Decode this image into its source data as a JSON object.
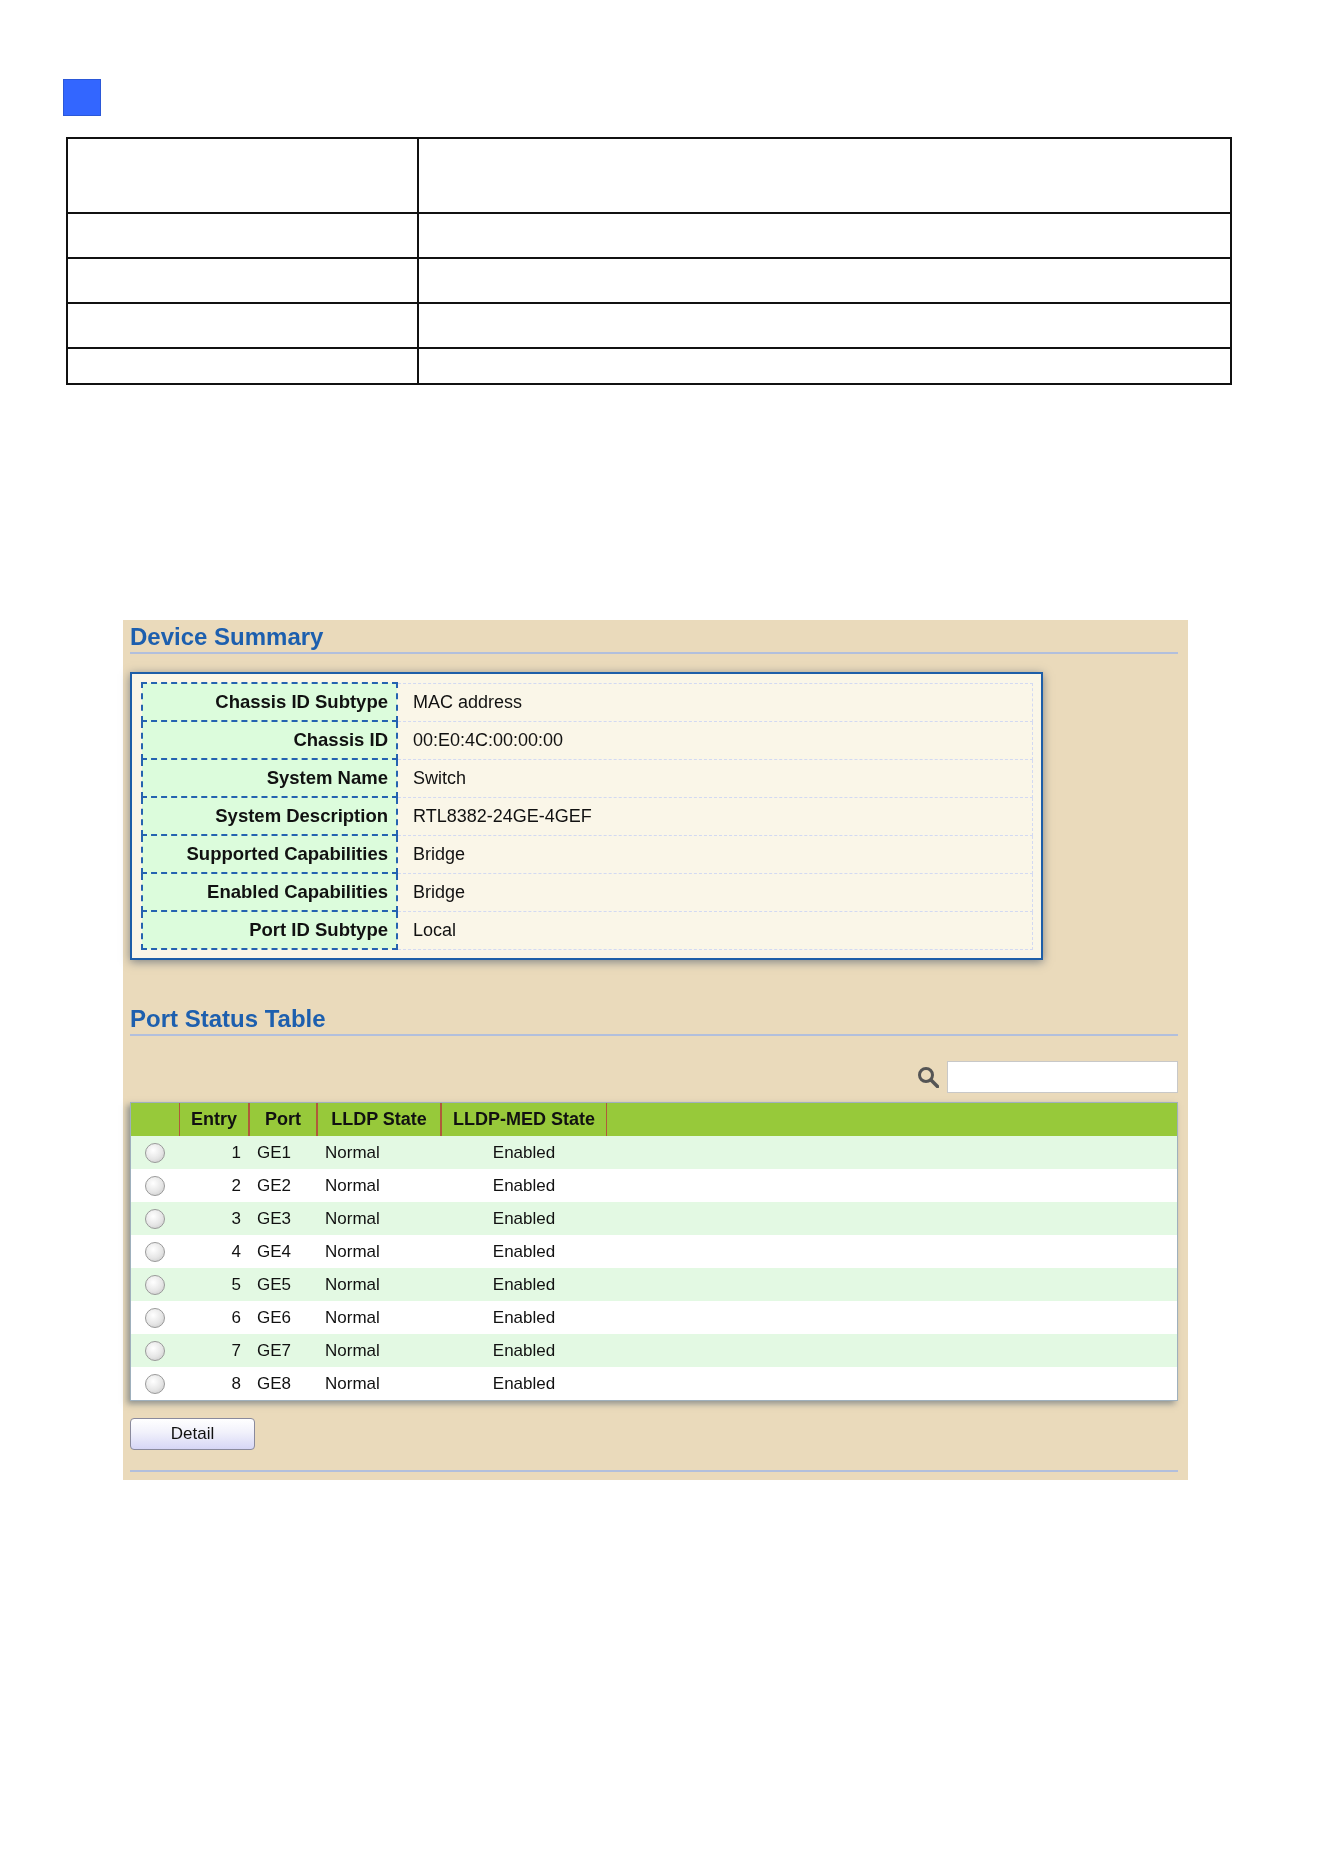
{
  "device_summary": {
    "title": "Device Summary",
    "rows": [
      {
        "label": "Chassis ID Subtype",
        "value": "MAC address"
      },
      {
        "label": "Chassis ID",
        "value": "00:E0:4C:00:00:00"
      },
      {
        "label": "System Name",
        "value": "Switch"
      },
      {
        "label": "System Description",
        "value": "RTL8382-24GE-4GEF"
      },
      {
        "label": "Supported Capabilities",
        "value": "Bridge"
      },
      {
        "label": "Enabled Capabilities",
        "value": "Bridge"
      },
      {
        "label": "Port ID Subtype",
        "value": "Local"
      }
    ]
  },
  "port_status_table": {
    "title": "Port Status Table",
    "columns": [
      "Entry",
      "Port",
      "LLDP State",
      "LLDP-MED State"
    ],
    "rows": [
      {
        "selected": false,
        "cells": [
          "1",
          "GE1",
          "Normal",
          "Enabled"
        ]
      },
      {
        "selected": false,
        "cells": [
          "2",
          "GE2",
          "Normal",
          "Enabled"
        ]
      },
      {
        "selected": false,
        "cells": [
          "3",
          "GE3",
          "Normal",
          "Enabled"
        ]
      },
      {
        "selected": false,
        "cells": [
          "4",
          "GE4",
          "Normal",
          "Enabled"
        ]
      },
      {
        "selected": false,
        "cells": [
          "5",
          "GE5",
          "Normal",
          "Enabled"
        ]
      },
      {
        "selected": false,
        "cells": [
          "6",
          "GE6",
          "Normal",
          "Enabled"
        ]
      },
      {
        "selected": false,
        "cells": [
          "7",
          "GE7",
          "Normal",
          "Enabled"
        ]
      },
      {
        "selected": false,
        "cells": [
          "8",
          "GE8",
          "Normal",
          "Enabled"
        ]
      }
    ]
  },
  "buttons": [
    "Detail"
  ]
}
